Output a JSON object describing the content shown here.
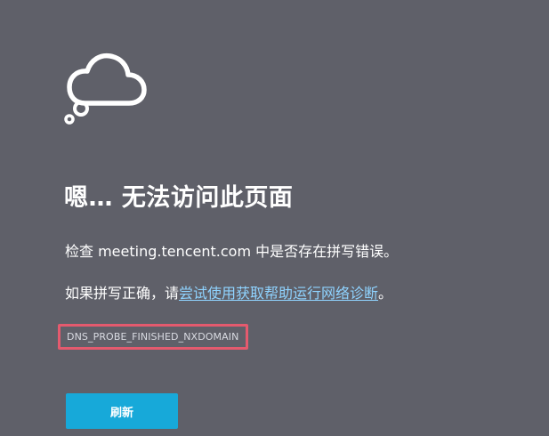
{
  "page": {
    "icon": "cloud-icon",
    "background_color": "#5f6069",
    "title": "嗯… 无法访问此页面",
    "line1": "检查 meeting.tencent.com 中是否存在拼写错误。",
    "line2_prefix": "如果拼写正确，请",
    "line2_link": "尝试使用获取帮助运行网络诊断",
    "line2_suffix": "。",
    "error_code": "DNS_PROBE_FINISHED_NXDOMAIN",
    "refresh_label": "刷新",
    "link_color": "#8fd3ff",
    "highlight_color": "#e45a6e",
    "button_color": "#17a9d9"
  }
}
